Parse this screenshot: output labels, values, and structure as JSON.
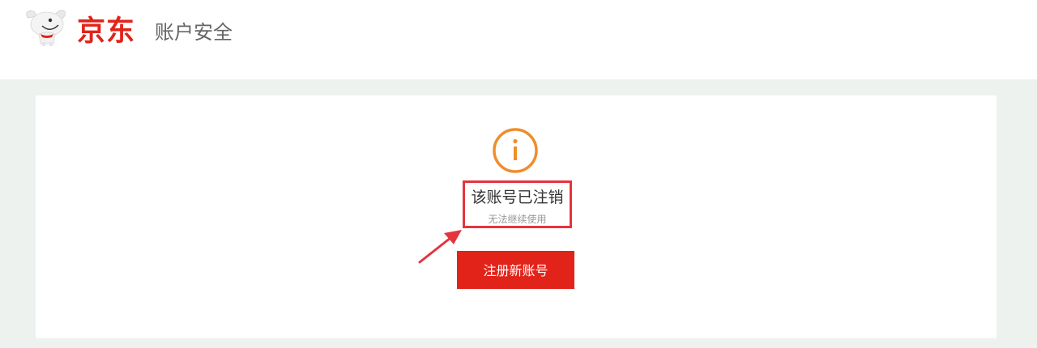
{
  "header": {
    "logo_text": "京东",
    "logo_mascot_icon": "jd-dog-mascot-icon",
    "title": "账户安全"
  },
  "notice": {
    "icon": "info-icon",
    "icon_color": "#f08d2c",
    "title": "该账号已注销",
    "subtitle": "无法继续使用"
  },
  "actions": {
    "register_label": "注册新账号"
  },
  "colors": {
    "brand_red": "#e2231a",
    "background_gray": "#eef2ee",
    "annotation_red": "#e5343f"
  }
}
